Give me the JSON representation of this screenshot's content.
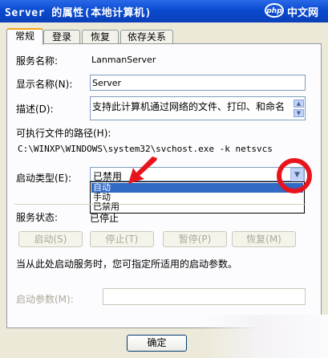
{
  "window": {
    "title": "Server 的属性(本地计算机)"
  },
  "watermark": {
    "badge": "php",
    "text": "中文网"
  },
  "tabs": [
    "常规",
    "登录",
    "恢复",
    "依存关系"
  ],
  "general": {
    "service_name_label": "服务名称:",
    "service_name": "LanmanServer",
    "display_name_label": "显示名称(N):",
    "display_name": "Server",
    "description_label": "描述(D):",
    "description": "支持此计算机通过网络的文件、打印、和命名",
    "exe_path_label": "可执行文件的路径(H):",
    "exe_path": "C:\\WINXP\\WINDOWS\\system32\\svchost.exe -k netsvcs",
    "startup_type_label": "启动类型(E):",
    "startup_type_value": "已禁用",
    "startup_options": [
      "自动",
      "手动",
      "已禁用"
    ],
    "selected_option_index": 0,
    "status_label": "服务状态:",
    "status_value": "已停止",
    "buttons": {
      "start": "启动(S)",
      "stop": "停止(T)",
      "pause": "暂停(P)",
      "resume": "恢复(M)"
    },
    "hint": "当从此处启动服务时，您可指定所适用的启动参数。",
    "params_label": "启动参数(M):",
    "params_value": ""
  },
  "footer": {
    "ok": "确定"
  },
  "annotation": {
    "color": "#e8141c"
  }
}
